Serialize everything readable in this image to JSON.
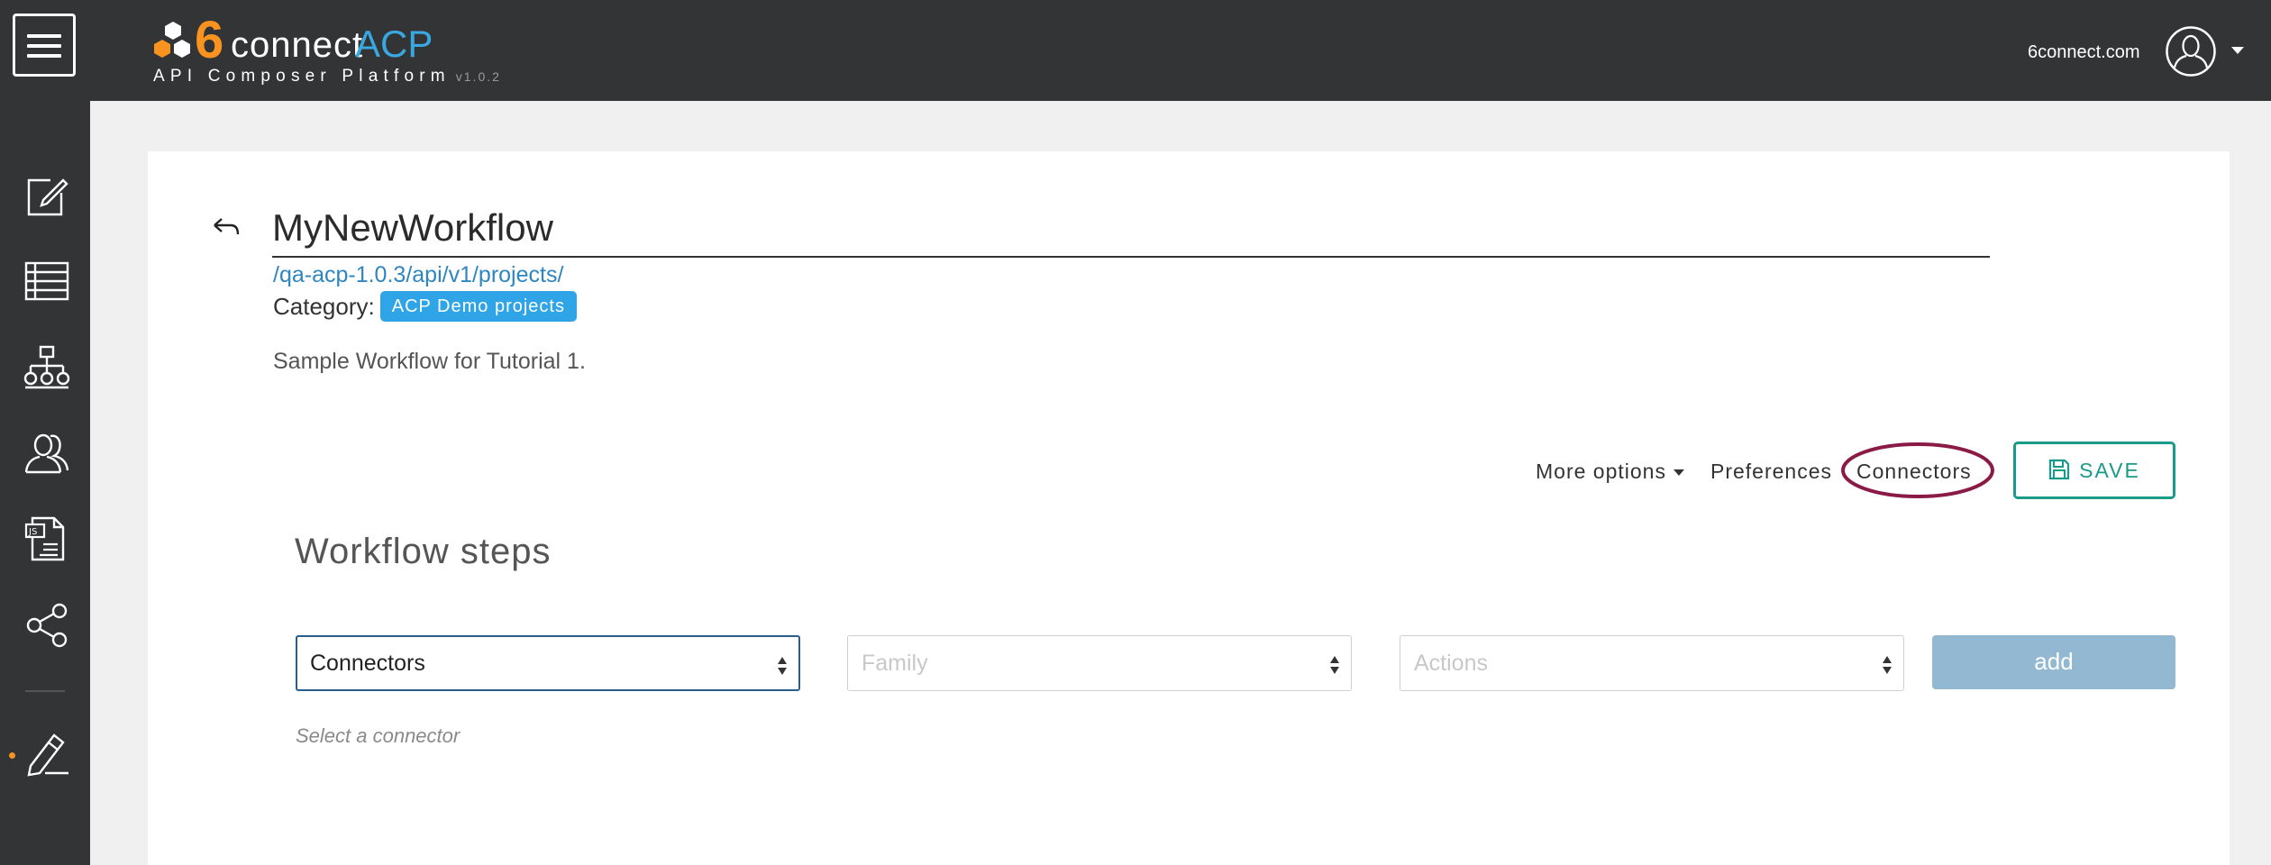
{
  "header": {
    "logo_six": "6",
    "logo_connect": "connect",
    "logo_acp": "ACP",
    "logo_subtitle": "API Composer Platform",
    "logo_version": "v1.0.2",
    "site_name": "6connect.com"
  },
  "sidebar": {
    "items": [
      {
        "icon": "edit-icon"
      },
      {
        "icon": "list-icon"
      },
      {
        "icon": "hierarchy-icon"
      },
      {
        "icon": "users-icon"
      },
      {
        "icon": "js-file-icon"
      },
      {
        "icon": "share-icon"
      },
      {
        "icon": "pen-icon",
        "active": true
      }
    ]
  },
  "workflow": {
    "title": "MyNewWorkflow",
    "path": "/qa-acp-1.0.3/api/v1/projects/",
    "category_label": "Category:",
    "category_badge": "ACP Demo projects",
    "description": "Sample Workflow for Tutorial 1."
  },
  "options": {
    "more_options": "More options",
    "preferences": "Preferences",
    "connectors": "Connectors",
    "save": "SAVE"
  },
  "steps": {
    "title": "Workflow steps",
    "connector_select_value": "Connectors",
    "family_placeholder": "Family",
    "actions_placeholder": "Actions",
    "add_label": "add",
    "hint": "Select a connector"
  },
  "colors": {
    "topbar": "#333436",
    "accent_orange": "#f7931e",
    "accent_blue": "#3aa8e0",
    "save_teal": "#1a9a8a",
    "highlight": "#8b1a46",
    "add_button": "#93b9d2"
  }
}
